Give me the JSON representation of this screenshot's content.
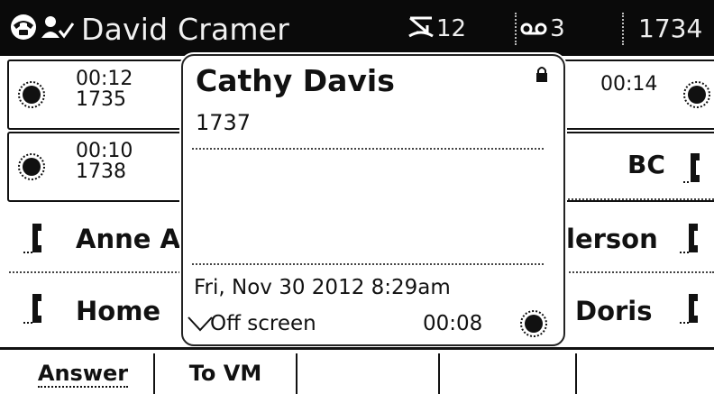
{
  "status_bar": {
    "user_name": "David Cramer",
    "missed_calls": "12",
    "voicemail": "3",
    "extension": "1734"
  },
  "call_rows": [
    {
      "time": "00:12",
      "number": "1735",
      "right_time": "00:14"
    },
    {
      "time": "00:10",
      "number": "1738",
      "right_name": "BC"
    }
  ],
  "contacts": [
    {
      "left_name": "Anne A",
      "right_name": "lerson"
    },
    {
      "left_name": "Home",
      "right_name": "Doris"
    }
  ],
  "popup": {
    "caller_name": "Cathy Davis",
    "caller_number": "1737",
    "datetime": "Fri, Nov 30 2012 8:29am",
    "off_screen_label": "Off screen",
    "duration": "00:08"
  },
  "softkeys": [
    "Answer",
    "To VM",
    "",
    "",
    ""
  ],
  "icons": {
    "status": "phone-status-icon",
    "user": "user-check-icon",
    "missed": "missed-call-icon",
    "voicemail": "voicemail-icon",
    "lock": "lock-icon",
    "call_active": "call-activity-icon",
    "handset": "handset-icon",
    "chevron": "chevron-down-icon"
  },
  "colors": {
    "topbar_bg": "#0a0a0a",
    "text": "#111111",
    "background": "#ffffff"
  }
}
